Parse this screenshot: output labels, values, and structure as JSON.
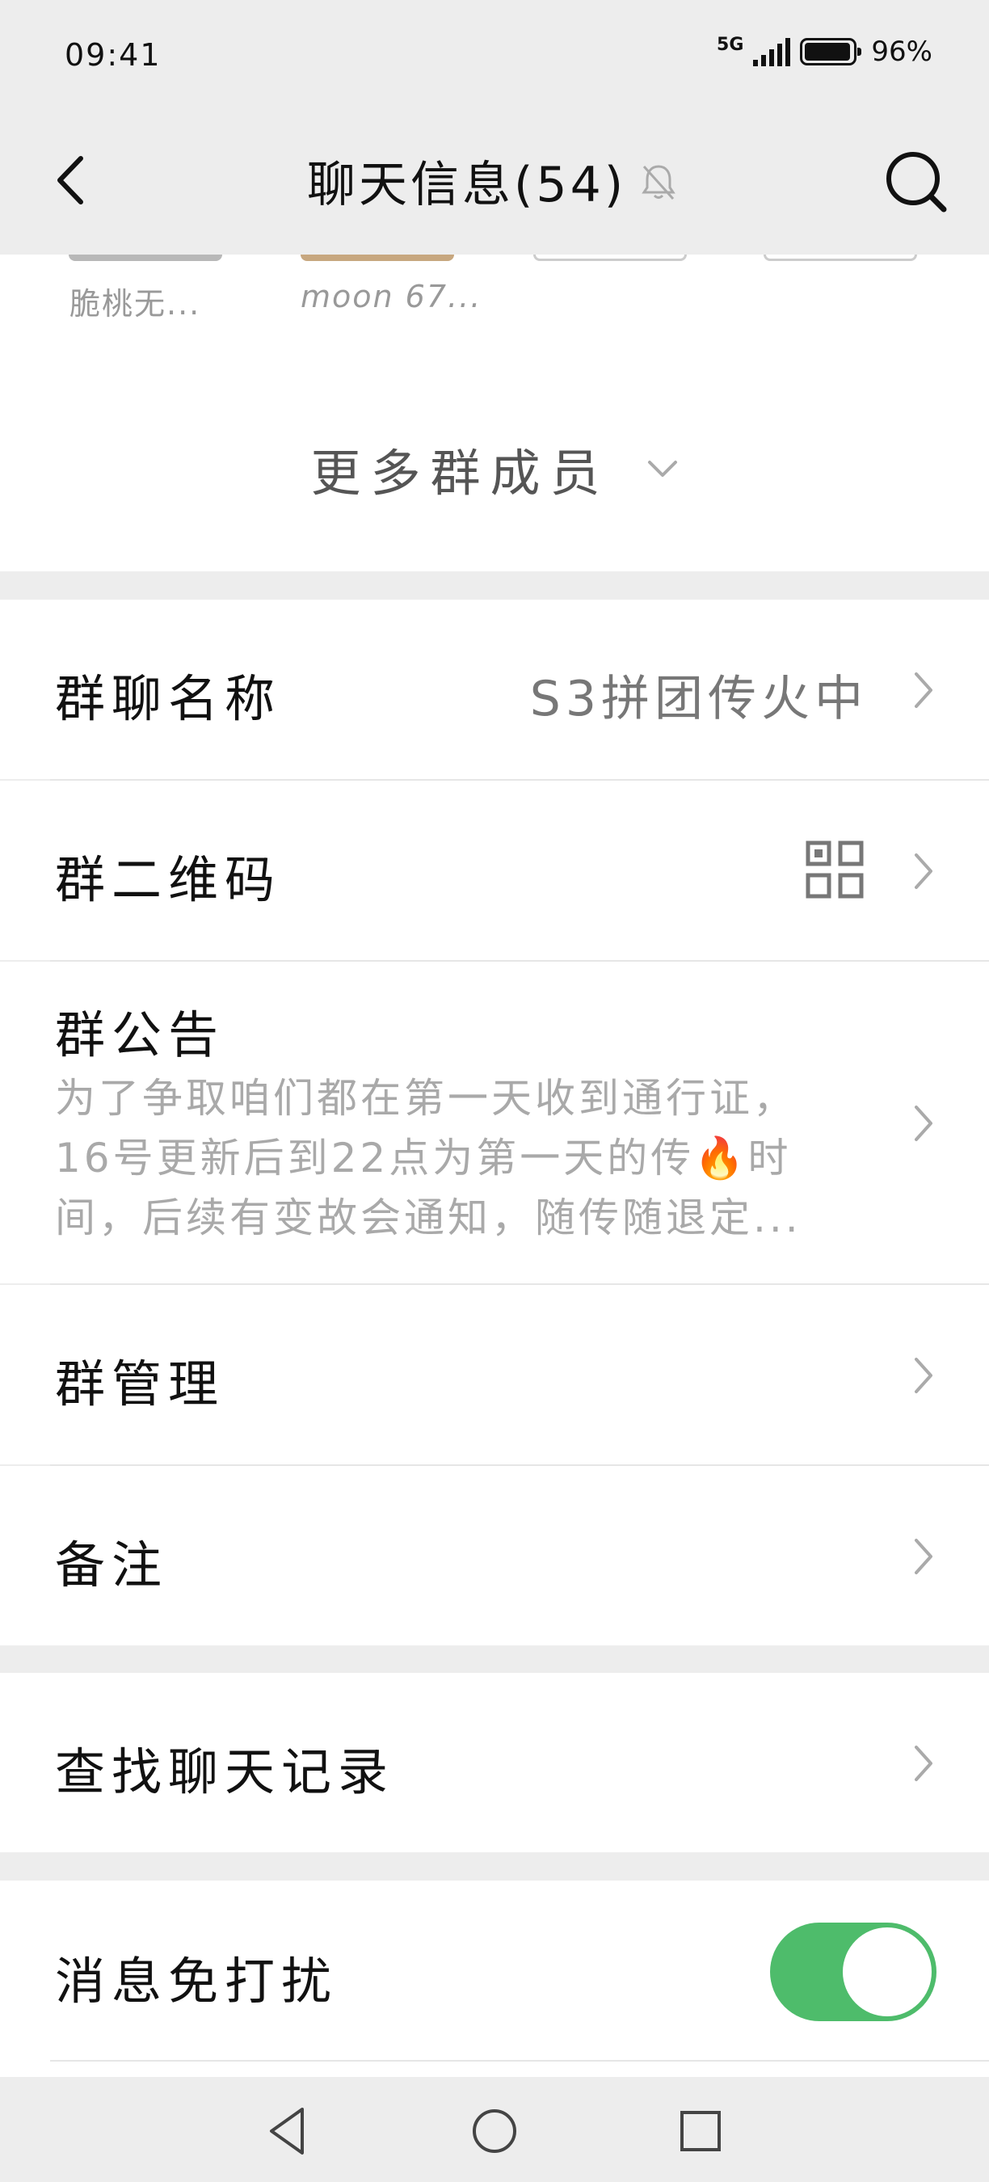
{
  "status": {
    "time": "09:41",
    "network": "5G",
    "battery": "96%"
  },
  "header": {
    "title": "聊天信息(54)",
    "back_icon": "chevron-left-icon",
    "mute_icon": "bell-off-icon",
    "search_icon": "search-icon"
  },
  "members": [
    {
      "name": "脆桃无..."
    },
    {
      "name": "moon 67..."
    }
  ],
  "more_members": {
    "label": "更多群成员"
  },
  "rows": {
    "group_name": {
      "label": "群聊名称",
      "value": "S3拼团传火中"
    },
    "group_qr": {
      "label": "群二维码",
      "icon": "qr-code-icon"
    },
    "announcement": {
      "label": "群公告",
      "lines": [
        "为了争取咱们都在第一天收到通行证，",
        "16号更新后到22点为第一天的传🔥时",
        "间，后续有变故会通知，随传随退定..."
      ]
    },
    "group_manage": {
      "label": "群管理"
    },
    "remark": {
      "label": "备注"
    },
    "search_history": {
      "label": "查找聊天记录"
    },
    "mute": {
      "label": "消息免打扰",
      "enabled": true
    }
  },
  "colors": {
    "accent": "#4ebc6b",
    "background": "#ededed",
    "muted_text": "#a9a9a9"
  },
  "navbar": {
    "back": "triangle-back-icon",
    "home": "circle-home-icon",
    "recents": "square-recents-icon"
  }
}
